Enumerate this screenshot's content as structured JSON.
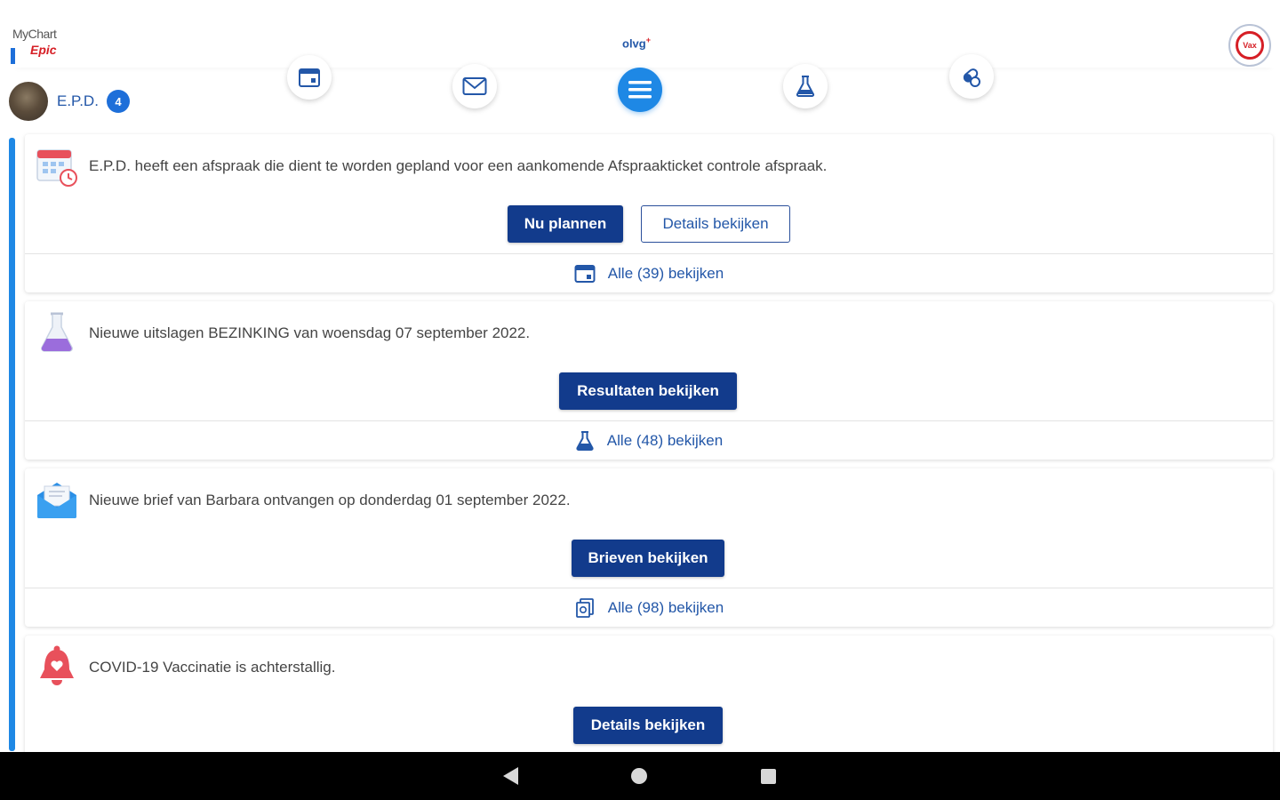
{
  "header": {
    "logo_line1": "MyChart",
    "logo_line2": "Epic",
    "org_logo": "olvg",
    "org_logo_sup": "+",
    "org_badge_text": "Vax"
  },
  "patient": {
    "name": "E.P.D.",
    "notification_count": "4"
  },
  "nav": [
    {
      "icon": "calendar-icon"
    },
    {
      "icon": "envelope-icon"
    },
    {
      "icon": "menu-icon",
      "active": true
    },
    {
      "icon": "flask-icon"
    },
    {
      "icon": "pills-icon"
    }
  ],
  "cards": [
    {
      "icon": "calendar-clock-icon",
      "text": "E.P.D. heeft een afspraak die dient te worden gepland voor een aankomende Afspraakticket controle afspraak.",
      "primary_button": "Nu plannen",
      "secondary_button": "Details bekijken",
      "footer": "Alle (39) bekijken"
    },
    {
      "icon": "flask-icon",
      "text": "Nieuwe uitslagen BEZINKING van woensdag 07 september 2022.",
      "primary_button": "Resultaten bekijken",
      "footer": "Alle (48) bekijken"
    },
    {
      "icon": "open-envelope-icon",
      "text": "Nieuwe brief van Barbara ontvangen op donderdag 01 september 2022.",
      "primary_button": "Brieven bekijken",
      "footer": "Alle (98) bekijken"
    },
    {
      "icon": "bell-icon",
      "text": "COVID-19 Vaccinatie is achterstallig.",
      "primary_button": "Details bekijken"
    }
  ],
  "colors": {
    "primary": "#123b8c",
    "accent": "#1e88e5",
    "link": "#2357a8"
  }
}
